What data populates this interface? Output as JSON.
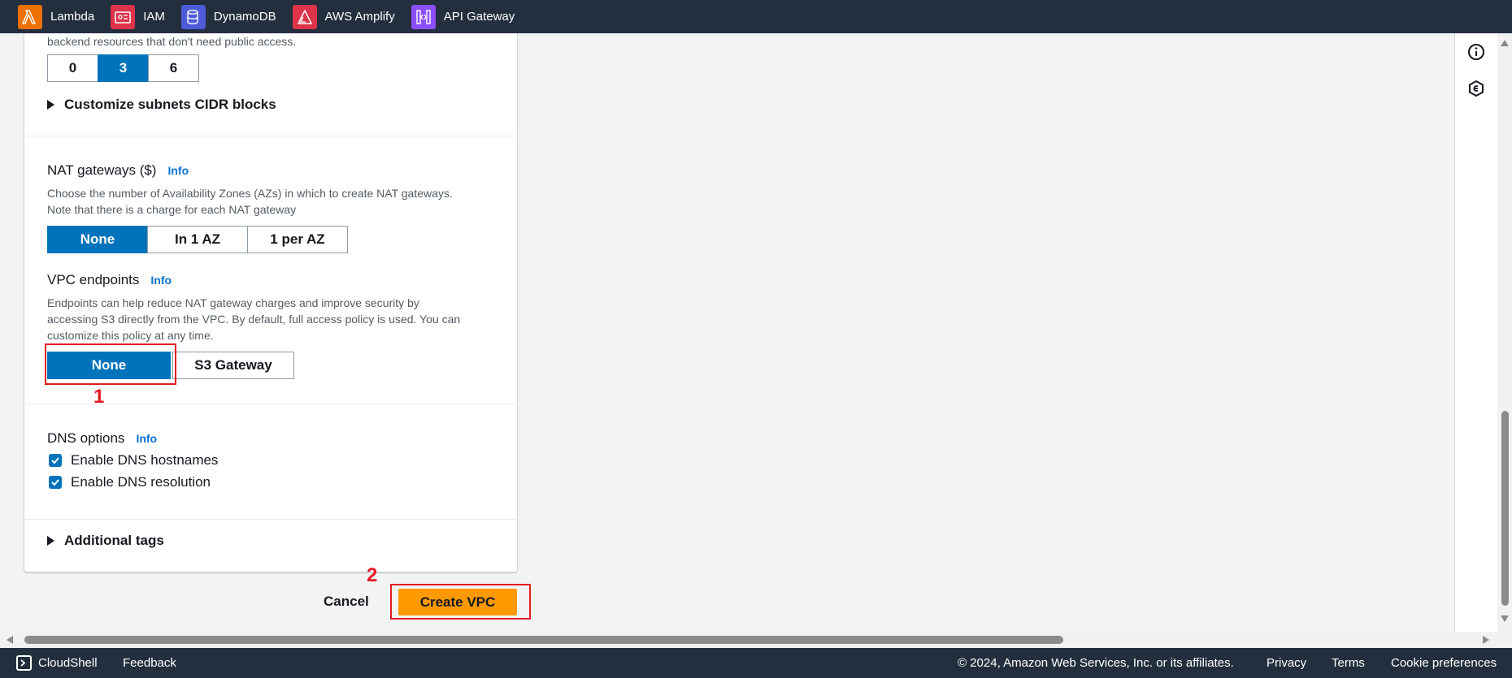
{
  "favorites": [
    {
      "label": "Lambda",
      "icon": "lambda-icon",
      "color": "#ed7100"
    },
    {
      "label": "IAM",
      "icon": "iam-icon",
      "color": "#dd344c"
    },
    {
      "label": "DynamoDB",
      "icon": "dynamodb-icon",
      "color": "#4d5bd9"
    },
    {
      "label": "AWS Amplify",
      "icon": "amplify-icon",
      "color": "#dd344c"
    },
    {
      "label": "API Gateway",
      "icon": "api-gateway-icon",
      "color": "#8c4fff"
    }
  ],
  "subnets": {
    "description_tail": "backend resources that don't need public access.",
    "options": [
      "0",
      "3",
      "6"
    ],
    "selected": "3",
    "customize_cidr_label": "Customize subnets CIDR blocks"
  },
  "nat": {
    "label": "NAT gateways ($)",
    "info": "Info",
    "description_line1": "Choose the number of Availability Zones (AZs) in which to create NAT gateways.",
    "description_line2": "Note that there is a charge for each NAT gateway",
    "options": [
      "None",
      "In 1 AZ",
      "1 per AZ"
    ],
    "selected": "None"
  },
  "vpc_endpoints": {
    "label": "VPC endpoints",
    "info": "Info",
    "description_line1": "Endpoints can help reduce NAT gateway charges and improve security by",
    "description_line2": "accessing S3 directly from the VPC. By default, full access policy is used. You can",
    "description_line3": "customize this policy at any time.",
    "options": [
      "None",
      "S3 Gateway"
    ],
    "selected": "None"
  },
  "dns": {
    "label": "DNS options",
    "info": "Info",
    "hostnames_label": "Enable DNS hostnames",
    "hostnames_checked": true,
    "resolution_label": "Enable DNS resolution",
    "resolution_checked": true
  },
  "additional_tags_label": "Additional tags",
  "actions": {
    "cancel_label": "Cancel",
    "create_label": "Create VPC"
  },
  "annotations": {
    "step1": "1",
    "step2": "2",
    "color": "#e31b23"
  },
  "footer": {
    "cloudshell": "CloudShell",
    "feedback": "Feedback",
    "copyright": "© 2024, Amazon Web Services, Inc. or its affiliates.",
    "privacy": "Privacy",
    "terms": "Terms",
    "cookie": "Cookie preferences"
  },
  "colors": {
    "accent_blue": "#0073bb",
    "primary_orange": "#ff9900",
    "nav_dark": "#232f3e"
  }
}
